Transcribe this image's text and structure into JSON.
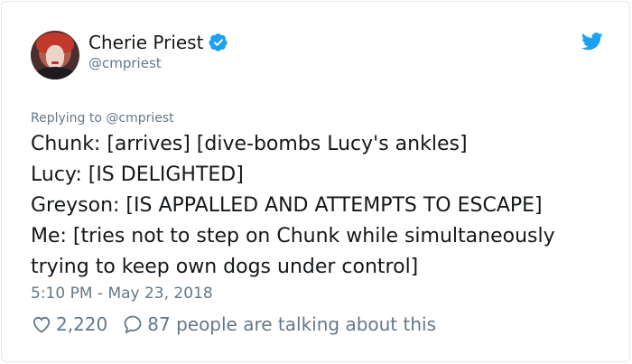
{
  "author": {
    "name": "Cherie Priest",
    "handle": "@cmpriest",
    "verified": true
  },
  "tweet": {
    "replying_to": "Replying to @cmpriest",
    "text": "Chunk: [arrives] [dive-bombs Lucy's ankles]\nLucy: [IS DELIGHTED]\nGreyson: [IS APPALLED AND ATTEMPTS TO ESCAPE]\nMe: [tries not to step on Chunk while simultaneously trying to keep own dogs under control]",
    "timestamp": "5:10 PM - May 23, 2018"
  },
  "stats": {
    "likes": "2,220",
    "conversation": "87 people are talking about this"
  },
  "colors": {
    "twitter_blue": "#1da1f2",
    "text": "#14171a",
    "secondary": "#657786",
    "border": "#e1e8ed"
  },
  "icons": {
    "verified": "verified-badge-icon",
    "logo": "twitter-bird-icon",
    "like": "heart-icon",
    "reply": "speech-bubble-icon"
  }
}
